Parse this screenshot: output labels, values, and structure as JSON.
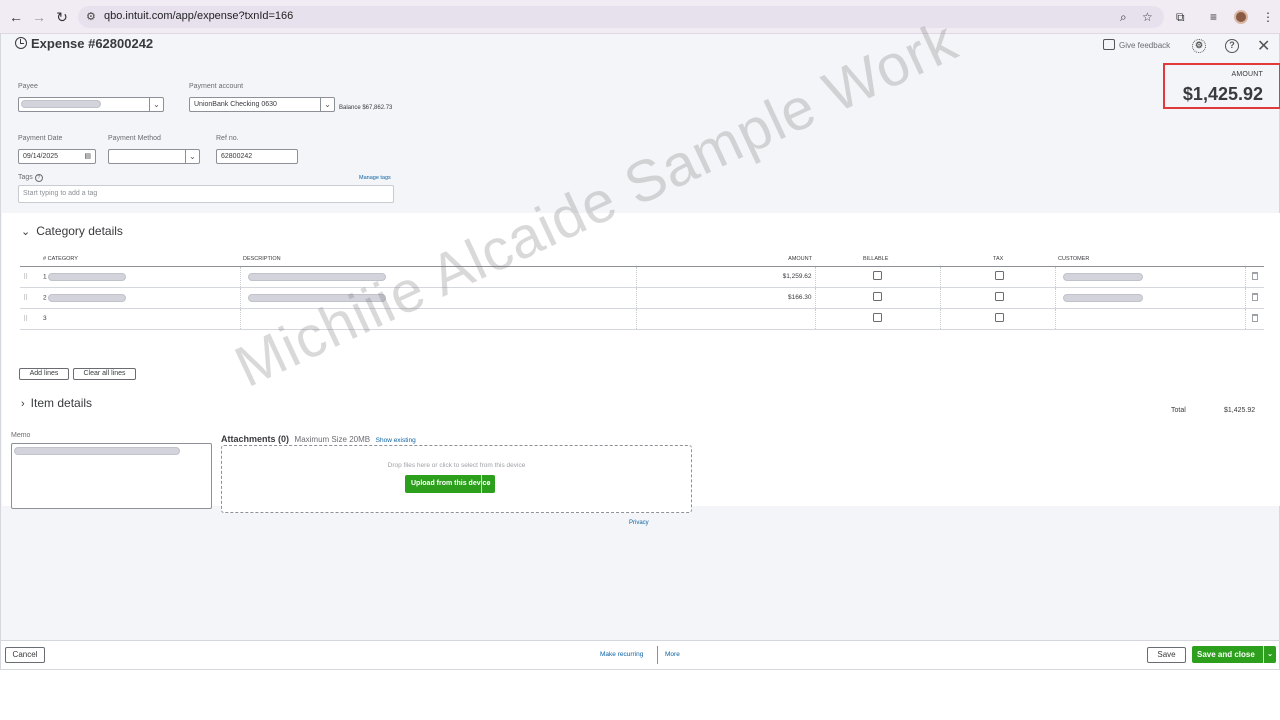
{
  "browser": {
    "url": "qbo.intuit.com/app/expense?txnId=166"
  },
  "header": {
    "title": "Expense #62800242",
    "give_feedback": "Give feedback",
    "amount_label": "AMOUNT",
    "amount_value": "$1,425.92"
  },
  "form": {
    "payee_label": "Payee",
    "payment_account_label": "Payment account",
    "payment_account_value": "UnionBank Checking 0630",
    "balance_text": "Balance $67,862.73",
    "payment_date_label": "Payment Date",
    "payment_date_value": "09/14/2025",
    "payment_method_label": "Payment Method",
    "ref_no_label": "Ref no.",
    "ref_no_value": "62800242",
    "tags_label": "Tags",
    "manage_tags": "Manage tags",
    "tags_placeholder": "Start typing to add a tag"
  },
  "category_details": {
    "title": "Category details",
    "columns": {
      "num": "#",
      "category": "CATEGORY",
      "description": "DESCRIPTION",
      "amount": "AMOUNT",
      "billable": "BILLABLE",
      "tax": "TAX",
      "customer": "CUSTOMER"
    },
    "rows": [
      {
        "num": "1",
        "amount": "$1,259.62"
      },
      {
        "num": "2",
        "amount": "$166.30"
      },
      {
        "num": "3",
        "amount": ""
      }
    ],
    "add_lines": "Add lines",
    "clear_all_lines": "Clear all lines"
  },
  "item_details": {
    "title": "Item details"
  },
  "totals": {
    "label": "Total",
    "value": "$1,425.92"
  },
  "memo": {
    "label": "Memo"
  },
  "attachments": {
    "title": "Attachments (0)",
    "max_size": "Maximum Size 20MB",
    "show_existing": "Show existing",
    "drop_text": "Drop files here or click to select from this device",
    "upload_button": "Upload from this device",
    "privacy": "Privacy"
  },
  "footer": {
    "cancel": "Cancel",
    "make_recurring": "Make recurring",
    "more": "More",
    "save": "Save",
    "save_and_close": "Save and close"
  },
  "watermark": "Michiiie Alcaide Sample Work",
  "colors": {
    "accent_green": "#2ca01c",
    "link_blue": "#0b62a4",
    "highlight_red": "#e03a3a"
  }
}
